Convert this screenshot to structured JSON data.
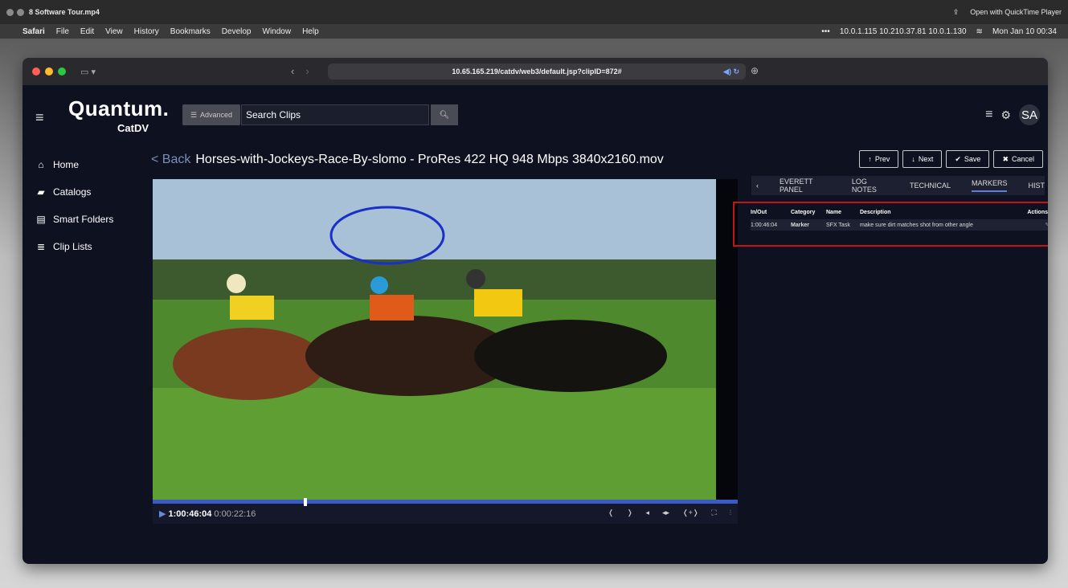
{
  "quicktime": {
    "title": "8 Software Tour.mp4",
    "open_with": "Open with QuickTime Player"
  },
  "menubar": {
    "items": [
      "Safari",
      "File",
      "Edit",
      "View",
      "History",
      "Bookmarks",
      "Develop",
      "Window",
      "Help"
    ],
    "ips": "10.0.1.115  10.210.37.81  10.0.1.130",
    "datetime": "Mon Jan 10  00:34"
  },
  "browser": {
    "url": "10.65.165.219/catdv/web3/default.jsp?clipID=872#"
  },
  "app": {
    "logo_main": "Quantum.",
    "logo_sub": "CatDV",
    "advanced_label": "Advanced",
    "search_value": "Search Clips",
    "avatar": "SA",
    "nav": [
      {
        "label": "Home",
        "icon": "home-icon"
      },
      {
        "label": "Catalogs",
        "icon": "catalog-icon"
      },
      {
        "label": "Smart Folders",
        "icon": "smart-folder-icon"
      },
      {
        "label": "Clip Lists",
        "icon": "list-icon"
      }
    ],
    "back": "< Back",
    "clip_title": "Horses-with-Jockeys-Race-By-slomo - ProRes 422 HQ 948 Mbps 3840x2160.mov",
    "buttons": {
      "prev": "Prev",
      "next": "Next",
      "save": "Save",
      "cancel": "Cancel"
    },
    "timecode": "1:00:46:04",
    "duration": "0:00:22:16",
    "tabs": [
      "EVERETT PANEL",
      "LOG NOTES",
      "TECHNICAL",
      "MARKERS",
      "HIST"
    ],
    "markers": {
      "headers": [
        "In/Out",
        "Category",
        "Name",
        "Description",
        "Actions"
      ],
      "rows": [
        {
          "inout": "1:00:46:04",
          "category": "Marker",
          "name": "SFX Task",
          "description": "make sure dirt matches shot from other angle"
        }
      ]
    }
  }
}
